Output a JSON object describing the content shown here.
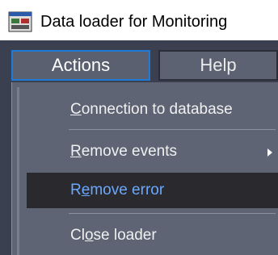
{
  "window": {
    "title": "Data loader for Monitoring",
    "icon": "app-monitor-icon"
  },
  "menubar": {
    "items": [
      {
        "label": "Actions",
        "state": "open"
      },
      {
        "label": "Help"
      }
    ]
  },
  "actions_menu": {
    "items": [
      {
        "label_pre": "",
        "mnemonic": "C",
        "label_post": "onnection to database"
      },
      {
        "label_pre": "",
        "mnemonic": "R",
        "label_post": "emove events",
        "submenu": true
      },
      {
        "label_pre": "R",
        "mnemonic": "e",
        "label_post": "move error",
        "highlighted": true
      },
      {
        "label_pre": "Cl",
        "mnemonic": "o",
        "label_post": "se loader"
      }
    ]
  },
  "colors": {
    "highlight_text": "#6aa8ff",
    "focus_border": "#1e7ad6"
  }
}
